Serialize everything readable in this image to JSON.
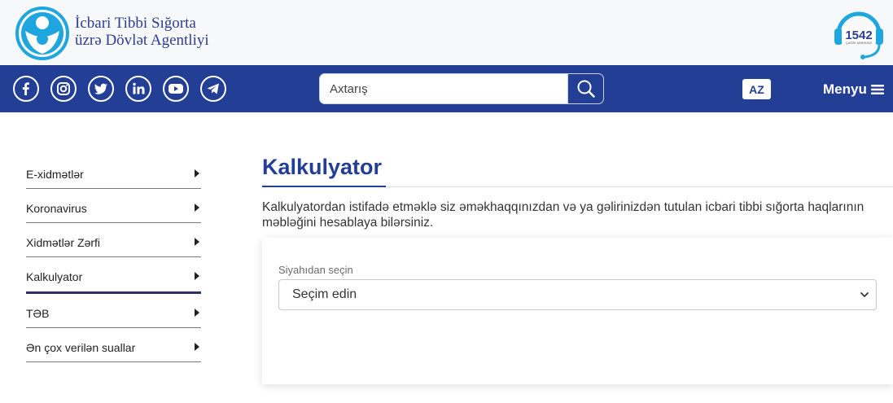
{
  "header": {
    "org_name_line1": "İcbari Tibbi Sığorta",
    "org_name_line2": "üzrə Dövlət Agentliyi",
    "hotline_number": "1542",
    "hotline_caption": "ÇAĞRI MƏRKƏZİ"
  },
  "nav": {
    "social": [
      {
        "name": "facebook-icon"
      },
      {
        "name": "instagram-icon"
      },
      {
        "name": "twitter-icon"
      },
      {
        "name": "linkedin-icon"
      },
      {
        "name": "youtube-icon"
      },
      {
        "name": "telegram-icon"
      }
    ],
    "search_placeholder": "Axtarış",
    "language": "AZ",
    "menu_label": "Menyu"
  },
  "sidebar": {
    "items": [
      {
        "label": "E-xidmətlər"
      },
      {
        "label": "Koronavirus"
      },
      {
        "label": "Xidmətlər Zərfi"
      },
      {
        "label": "Kalkulyator",
        "active": true
      },
      {
        "label": "TƏB"
      },
      {
        "label": "Ən çox verilən suallar"
      }
    ]
  },
  "main": {
    "title": "Kalkulyator",
    "intro": "Kalkulyatordan istifadə etməklə siz əməkhaqqınızdan və ya gəlirinizdən tutulan icbari tibbi sığorta haqlarının məbləğini hesablaya bilərsiniz.",
    "select_label": "Siyahıdan seçin",
    "select_value": "Seçim edin"
  },
  "colors": {
    "brand_blue": "#223e95",
    "logo_cyan": "#1fa6de",
    "topbar_bg": "#f7f8fa"
  }
}
